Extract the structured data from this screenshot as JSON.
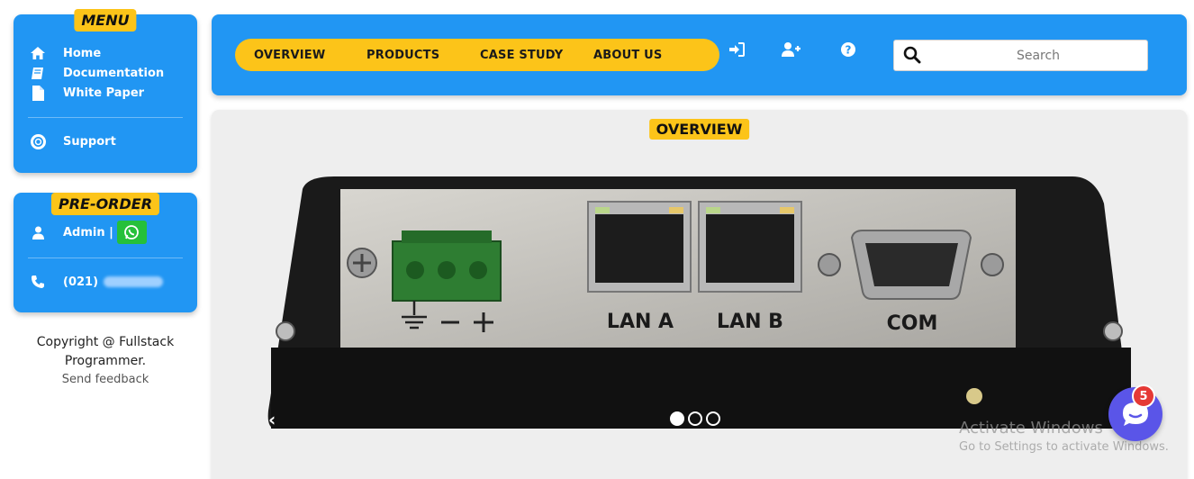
{
  "sidebar": {
    "menu_title": "MENU",
    "menu_items": [
      {
        "label": "Home",
        "icon": "home-icon"
      },
      {
        "label": "Documentation",
        "icon": "book-icon"
      },
      {
        "label": "White Paper",
        "icon": "file-icon"
      },
      {
        "label": "Support",
        "icon": "lifebuoy-icon"
      }
    ],
    "preorder_title": "PRE-ORDER",
    "admin_label": "Admin |",
    "phone_prefix": "(021)",
    "copyright": "Copyright @ Fullstack Programmer.",
    "feedback": "Send feedback"
  },
  "nav": {
    "links": [
      "OVERVIEW",
      "PRODUCTS",
      "CASE STUDY",
      "ABOUT US"
    ],
    "icons": [
      "sign-in-icon",
      "add-user-icon",
      "help-icon"
    ]
  },
  "search": {
    "placeholder": "Search",
    "value": ""
  },
  "main": {
    "title": "OVERVIEW",
    "device_labels": {
      "lan_a": "LAN A",
      "lan_b": "LAN B",
      "com": "COM"
    },
    "carousel_prev": "‹",
    "carousel_slides": 3,
    "active_slide": 1
  },
  "watermark": {
    "line1": "Activate Windows",
    "line2": "Go to Settings to activate Windows."
  },
  "chat": {
    "badge": "5"
  },
  "colors": {
    "primary": "#2196f3",
    "accent": "#fcc419",
    "chat": "#5a55e8",
    "badge": "#e53935"
  }
}
